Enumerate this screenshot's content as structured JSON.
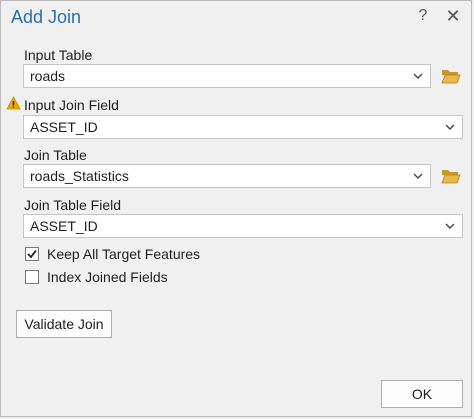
{
  "window": {
    "title": "Add Join",
    "help_glyph": "?",
    "close_glyph": "✕"
  },
  "fields": {
    "input_table": {
      "label": "Input Table",
      "value": "roads"
    },
    "input_join_field": {
      "label": "Input Join Field",
      "value": "ASSET_ID",
      "warning": true
    },
    "join_table": {
      "label": "Join Table",
      "value": "roads_Statistics"
    },
    "join_table_field": {
      "label": "Join Table Field",
      "value": "ASSET_ID"
    }
  },
  "options": {
    "keep_all": {
      "label": "Keep All Target Features",
      "checked": true
    },
    "index_joined": {
      "label": "Index Joined Fields",
      "checked": false
    }
  },
  "buttons": {
    "validate_join": "Validate Join",
    "ok": "OK"
  },
  "icons": {
    "folder": "folder-open-icon",
    "warning": "warning-icon",
    "dropdown": "chevron-down-icon"
  },
  "colors": {
    "title": "#2a6fb0",
    "folder": "#e8b84a",
    "warning": "#f2a900"
  }
}
